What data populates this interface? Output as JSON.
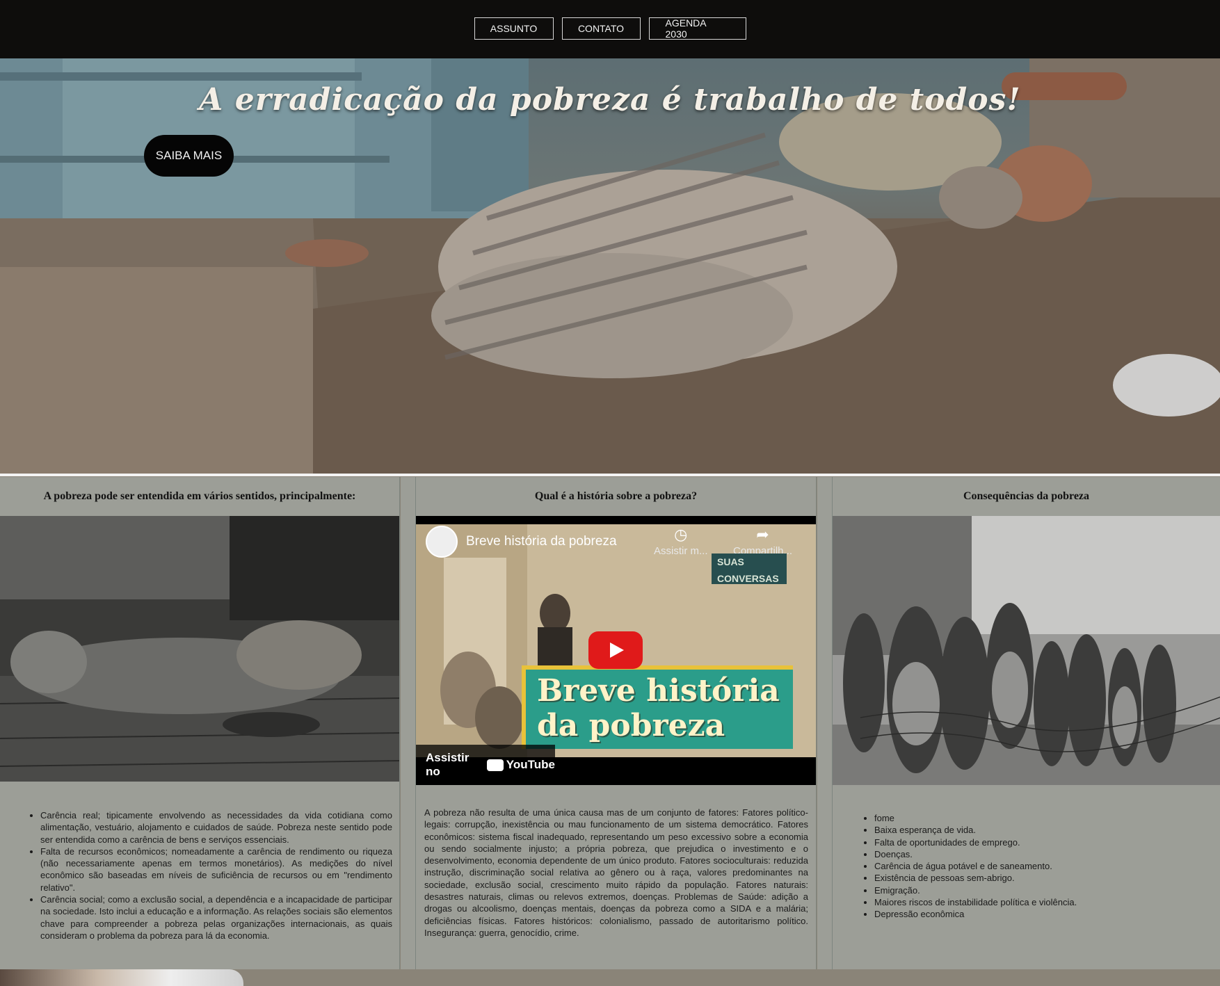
{
  "nav": {
    "items": [
      {
        "label": "ASSUNTO"
      },
      {
        "label": "CONTATO"
      },
      {
        "label": "AGENDA 2030"
      }
    ]
  },
  "hero": {
    "title": "A erradicação da pobreza é trabalho de todos!",
    "cta_label": "SAIBA MAIS"
  },
  "columns": {
    "left": {
      "title": "A pobreza pode ser entendida em vários sentidos, principalmente:",
      "items": [
        "Carência real; tipicamente envolvendo as necessidades da vida cotidiana como alimentação, vestuário, alojamento e cuidados de saúde. Pobreza neste sentido pode ser entendida como a carência de bens e serviços essenciais.",
        "Falta de recursos econômicos; nomeadamente a carência de rendimento ou riqueza (não necessariamente apenas em termos monetários). As medições do nível econômico são baseadas em níveis de suficiência de recursos ou em \"rendimento relativo\".",
        "Carência social; como a exclusão social, a dependência e a incapacidade de participar na sociedade. Isto inclui a educação e a informação. As relações sociais são elementos chave para compreender a pobreza pelas organizações internacionais, as quais consideram o problema da pobreza para lá da economia."
      ]
    },
    "middle": {
      "title": "Qual é a história sobre a pobreza?",
      "video": {
        "title": "Breve história da pobreza",
        "watch_later": "Assistir m...",
        "share": "Compartilh...",
        "watch_on": "Assistir no",
        "platform": "YouTube",
        "channel_tag_1": "SUAS",
        "channel_tag_2": "CONVERSAS",
        "banner_line_1": "Breve história",
        "banner_line_2": "da pobreza"
      },
      "text": "A pobreza não resulta de uma única causa mas de um conjunto de fatores: Fatores político-legais: corrupção, inexistência ou mau funcionamento de um sistema democrático. Fatores econômicos: sistema fiscal inadequado, representando um peso excessivo sobre a economia ou sendo socialmente injusto; a própria pobreza, que prejudica o investimento e o desenvolvimento, economia dependente de um único produto. Fatores socioculturais: reduzida instrução, discriminação social relativa ao gênero ou à raça, valores predominantes na sociedade, exclusão social, crescimento muito rápido da população. Fatores naturais: desastres naturais, climas ou relevos extremos, doenças. Problemas de Saúde: adição a drogas ou alcoolismo, doenças mentais, doenças da pobreza como a SIDA e a malária; deficiências físicas. Fatores históricos: colonialismo, passado de autoritarismo político. Insegurança: guerra, genocídio, crime."
    },
    "right": {
      "title": "Consequências da pobreza",
      "items": [
        "fome",
        "Baixa esperança de vida.",
        "Falta de oportunidades de emprego.",
        "Doenças.",
        "Carência de água potável e de saneamento.",
        "Existência de pessoas sem-abrigo.",
        "Emigração.",
        "Maiores riscos de instabilidade política e violência.",
        "Depressão econômica"
      ]
    }
  },
  "colors": {
    "topbar": "#0e0d0c",
    "panel": "#9c9e97",
    "accent_red": "#e01a1a",
    "banner_teal": "#2b9d8a"
  }
}
